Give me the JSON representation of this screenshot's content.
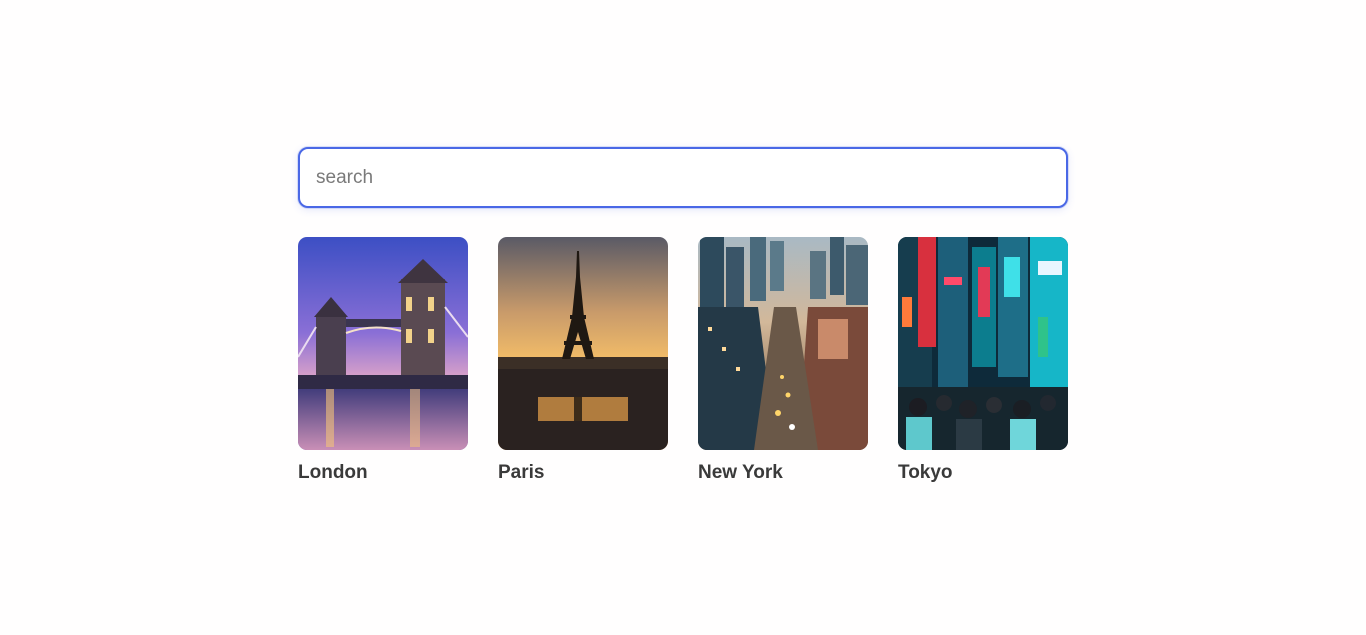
{
  "search": {
    "placeholder": "search",
    "value": ""
  },
  "cities": [
    {
      "name": "London",
      "image": "tower-bridge-at-dusk"
    },
    {
      "name": "Paris",
      "image": "eiffel-tower-at-sunset"
    },
    {
      "name": "New York",
      "image": "city-street-aerial"
    },
    {
      "name": "Tokyo",
      "image": "neon-street-at-night"
    }
  ],
  "colors": {
    "accent": "#4a68e6",
    "label": "#3a3a3a",
    "background": "#fffefe"
  }
}
